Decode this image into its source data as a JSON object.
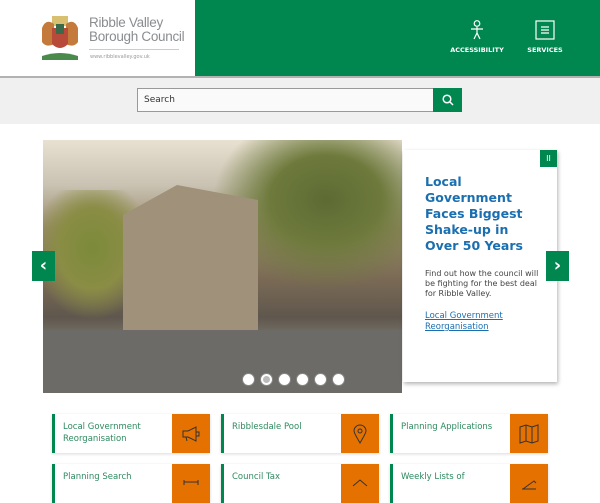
{
  "header": {
    "brand_line1": "Ribble Valley",
    "brand_line2": "Borough Council",
    "url": "www.ribblevalley.gov.uk",
    "accessibility": "ACCESSIBILITY",
    "services": "SERVICES"
  },
  "search": {
    "placeholder": "Search"
  },
  "hero": {
    "title": "Local Government Faces Biggest Shake-up in Over 50 Years",
    "body": "Find out how the council will be fighting for the best deal for Ribble Valley.",
    "link": "Local Government Reorganisation",
    "pause": "II",
    "prev": "‹",
    "next": "›",
    "slides": 6,
    "active_slide": 1
  },
  "tiles": [
    {
      "label": "Local Government Reorganisation",
      "icon": "megaphone-icon"
    },
    {
      "label": "Ribblesdale Pool",
      "icon": "map-pin-icon"
    },
    {
      "label": "Planning Applications",
      "icon": "map-icon"
    },
    {
      "label": "Planning Search",
      "icon": "plan-icon"
    },
    {
      "label": "Council Tax",
      "icon": "house-icon"
    },
    {
      "label": "Weekly Lists of",
      "icon": "pen-icon"
    }
  ],
  "colors": {
    "green": "#00874f",
    "orange": "#e57200",
    "blue": "#1a6fb0"
  }
}
